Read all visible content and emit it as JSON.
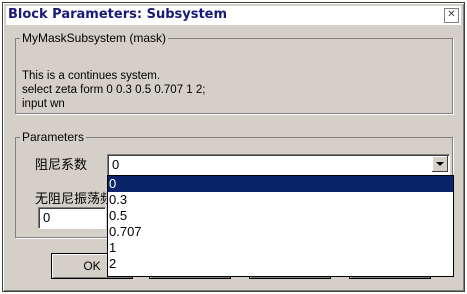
{
  "window": {
    "title": "Block Parameters: Subsystem",
    "close_glyph": "✕"
  },
  "mask_group": {
    "legend": "MyMaskSubsystem (mask)",
    "description_lines": [
      "This is a continues system.",
      "select zeta form 0 0.3 0.5 0.707 1 2;",
      "input wn"
    ]
  },
  "parameters": {
    "legend": "Parameters",
    "zeta_label": "阻尼系数",
    "zeta_value": "0",
    "wn_label": "无阻尼振荡频率",
    "wn_value": "0"
  },
  "dropdown": {
    "options": [
      "0",
      "0.3",
      "0.5",
      "0.707",
      "1",
      "2"
    ],
    "selected_index": 0
  },
  "buttons": {
    "ok_label": "OK"
  },
  "colors": {
    "dialog_bg": "#d4d0c8",
    "selection": "#0a246a",
    "title_text": "#1a1a7a"
  }
}
